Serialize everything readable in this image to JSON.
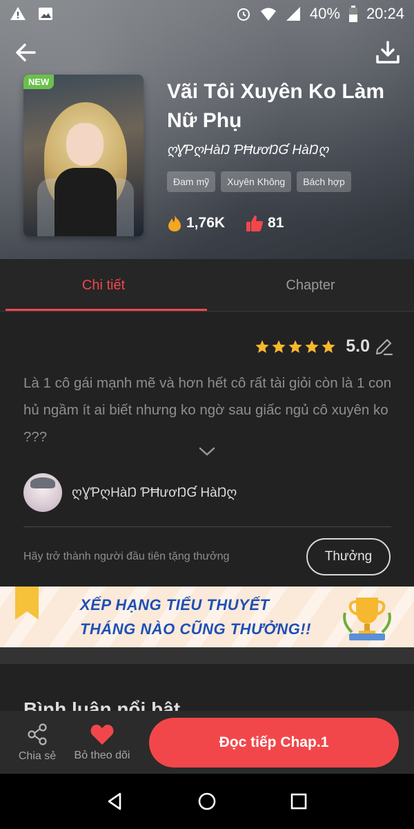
{
  "status_bar": {
    "battery": "40%",
    "time": "20:24"
  },
  "book": {
    "badge": "NEW",
    "title": "Vãi Tôi Xuyên Ko Làm Nữ Phụ",
    "author": "ღƔƤღHàŊ ƤĦươŊƓ HàŊღ",
    "tags": [
      "Đam mỹ",
      "Xuyên Không",
      "Bách hợp"
    ],
    "views": "1,76K",
    "likes": "81"
  },
  "tabs": [
    {
      "label": "Chi tiết",
      "active": true
    },
    {
      "label": "Chapter",
      "active": false
    }
  ],
  "details": {
    "rating": "5.0",
    "stars": 5,
    "description": "Là 1 cô gái mạnh mẽ và hơn hết cô rất tài giỏi còn là 1 con hủ ngầm ít ai biết nhưng ko ngờ sau giấc ngủ cô xuyên ko ???",
    "author_name": "ღƔƤღHàŊ ƤĦươŊƓ HàŊღ",
    "reward_text": "Hãy trở thành người đầu tiên tặng thưởng",
    "reward_button": "Thưởng"
  },
  "banner": {
    "line1": "XẾP HẠNG TIỂU THUYẾT",
    "line2": "THÁNG NÀO CŨNG THƯỞNG!!"
  },
  "comments_section": {
    "title": "Bình luận nổi bật"
  },
  "action_bar": {
    "share_label": "Chia sẻ",
    "follow_label": "Bỏ theo dõi",
    "read_label": "Đọc tiếp Chap.1"
  },
  "colors": {
    "accent": "#f2474a",
    "background": "#222222",
    "banner_text": "#1f4fb5"
  },
  "icons": [
    "warning-icon",
    "image-icon",
    "alarm-icon",
    "wifi-icon",
    "signal-icon",
    "battery-icon",
    "back-arrow-icon",
    "download-icon",
    "fire-icon",
    "thumbs-up-icon",
    "star-icon",
    "edit-icon",
    "chevron-down-icon",
    "share-icon",
    "heart-icon",
    "trophy-icon",
    "nav-back-icon",
    "nav-home-icon",
    "nav-recents-icon"
  ]
}
